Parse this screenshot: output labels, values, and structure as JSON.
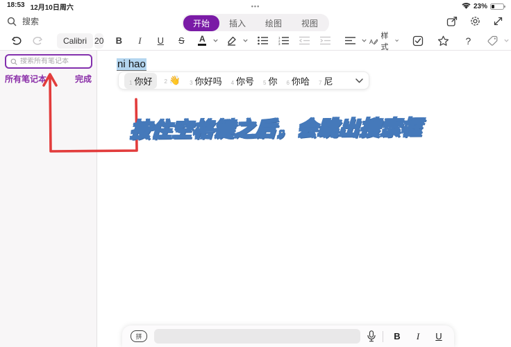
{
  "status_bar": {
    "time": "18:53",
    "date": "12月10日周六",
    "battery_percent": "23%",
    "ellipsis": "•••"
  },
  "ribbon": {
    "search_label": "搜索",
    "tabs": [
      {
        "label": "开始",
        "active": true
      },
      {
        "label": "插入",
        "active": false
      },
      {
        "label": "绘图",
        "active": false
      },
      {
        "label": "视图",
        "active": false
      }
    ]
  },
  "format_toolbar": {
    "font_name": "Calibri",
    "font_size": "20",
    "bold": "B",
    "italic": "I",
    "underline": "U",
    "strikethrough": "S",
    "font_color_letter": "A",
    "styles_label": "样式",
    "help": "?"
  },
  "sidebar": {
    "search_placeholder": "搜索所有笔记本",
    "all_notebooks_label": "所有笔记本",
    "done_label": "完成"
  },
  "editor": {
    "composition_text": "ni hao",
    "ime_candidates": [
      {
        "num": "1",
        "text": "你好",
        "selected": true
      },
      {
        "num": "2",
        "text": "👋",
        "selected": false
      },
      {
        "num": "3",
        "text": "你好吗",
        "selected": false
      },
      {
        "num": "4",
        "text": "你号",
        "selected": false
      },
      {
        "num": "5",
        "text": "你",
        "selected": false
      },
      {
        "num": "6",
        "text": "你哈",
        "selected": false
      },
      {
        "num": "7",
        "text": "尼",
        "selected": false
      }
    ],
    "annotation_text": "按住空格键之后，会跳出搜索框"
  },
  "input_bar": {
    "keyboard_badge": "拼",
    "bold": "B",
    "italic": "I",
    "underline": "U"
  },
  "colors": {
    "accent_purple": "#7a1ba6",
    "search_border_purple": "#8330ad",
    "arrow_red": "#e23c3c",
    "annotation_fill": "#fbf3d7",
    "annotation_outline": "#4579ba",
    "selection_blue": "#b4d6f0"
  }
}
